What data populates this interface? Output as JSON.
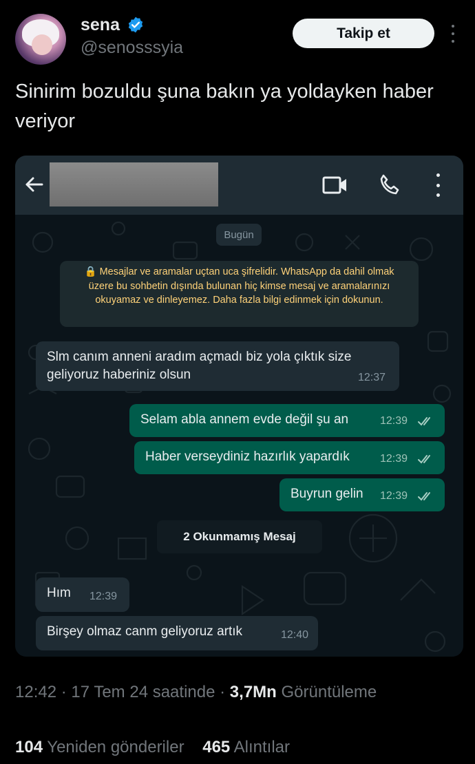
{
  "user": {
    "name": "sena",
    "handle": "@senosssyia",
    "follow_label": "Takip et"
  },
  "tweet": {
    "text": "Sinirim bozuldu şuna bakın ya yoldayken haber veriyor"
  },
  "chat": {
    "date_label": "Bugün",
    "encryption_notice": "🔒 Mesajlar ve aramalar uçtan uca şifrelidir. WhatsApp da dahil olmak üzere bu sohbetin dışında bulunan hiç kimse mesaj ve aramalarınızı okuyamaz ve dinleyemez. Daha fazla bilgi edinmek için dokunun.",
    "messages": [
      {
        "dir": "in",
        "text": "Slm canım anneni aradım açmadı biz yola çıktık size geliyoruz haberiniz olsun",
        "time": "12:37"
      },
      {
        "dir": "out",
        "text": "Selam abla annem evde değil şu an",
        "time": "12:39"
      },
      {
        "dir": "out",
        "text": "Haber verseydiniz hazırlık yapardık",
        "time": "12:39"
      },
      {
        "dir": "out",
        "text": "Buyrun gelin",
        "time": "12:39"
      },
      {
        "dir": "in",
        "text": "Hım",
        "time": "12:39"
      },
      {
        "dir": "in",
        "text": "Birşey olmaz canm geliyoruz artık",
        "time": "12:40"
      }
    ],
    "unread_label": "2 Okunmamış Mesaj",
    "colors": {
      "incoming": "#1f2c34",
      "outgoing": "#005c4b",
      "header": "#1f2c34",
      "background": "#0b141a"
    }
  },
  "meta": {
    "time": "12:42",
    "date_text": "17 Tem 24 saatinde",
    "views": "3,7Mn",
    "views_label": "Görüntüleme"
  },
  "stats": {
    "retweets": "104",
    "retweets_label": "Yeniden gönderiler",
    "quotes": "465",
    "quotes_label": "Alıntılar"
  },
  "icons": [
    "verified-badge-icon",
    "more-icon",
    "back-arrow-icon",
    "video-call-icon",
    "phone-icon",
    "menu-icon",
    "double-check-icon"
  ]
}
